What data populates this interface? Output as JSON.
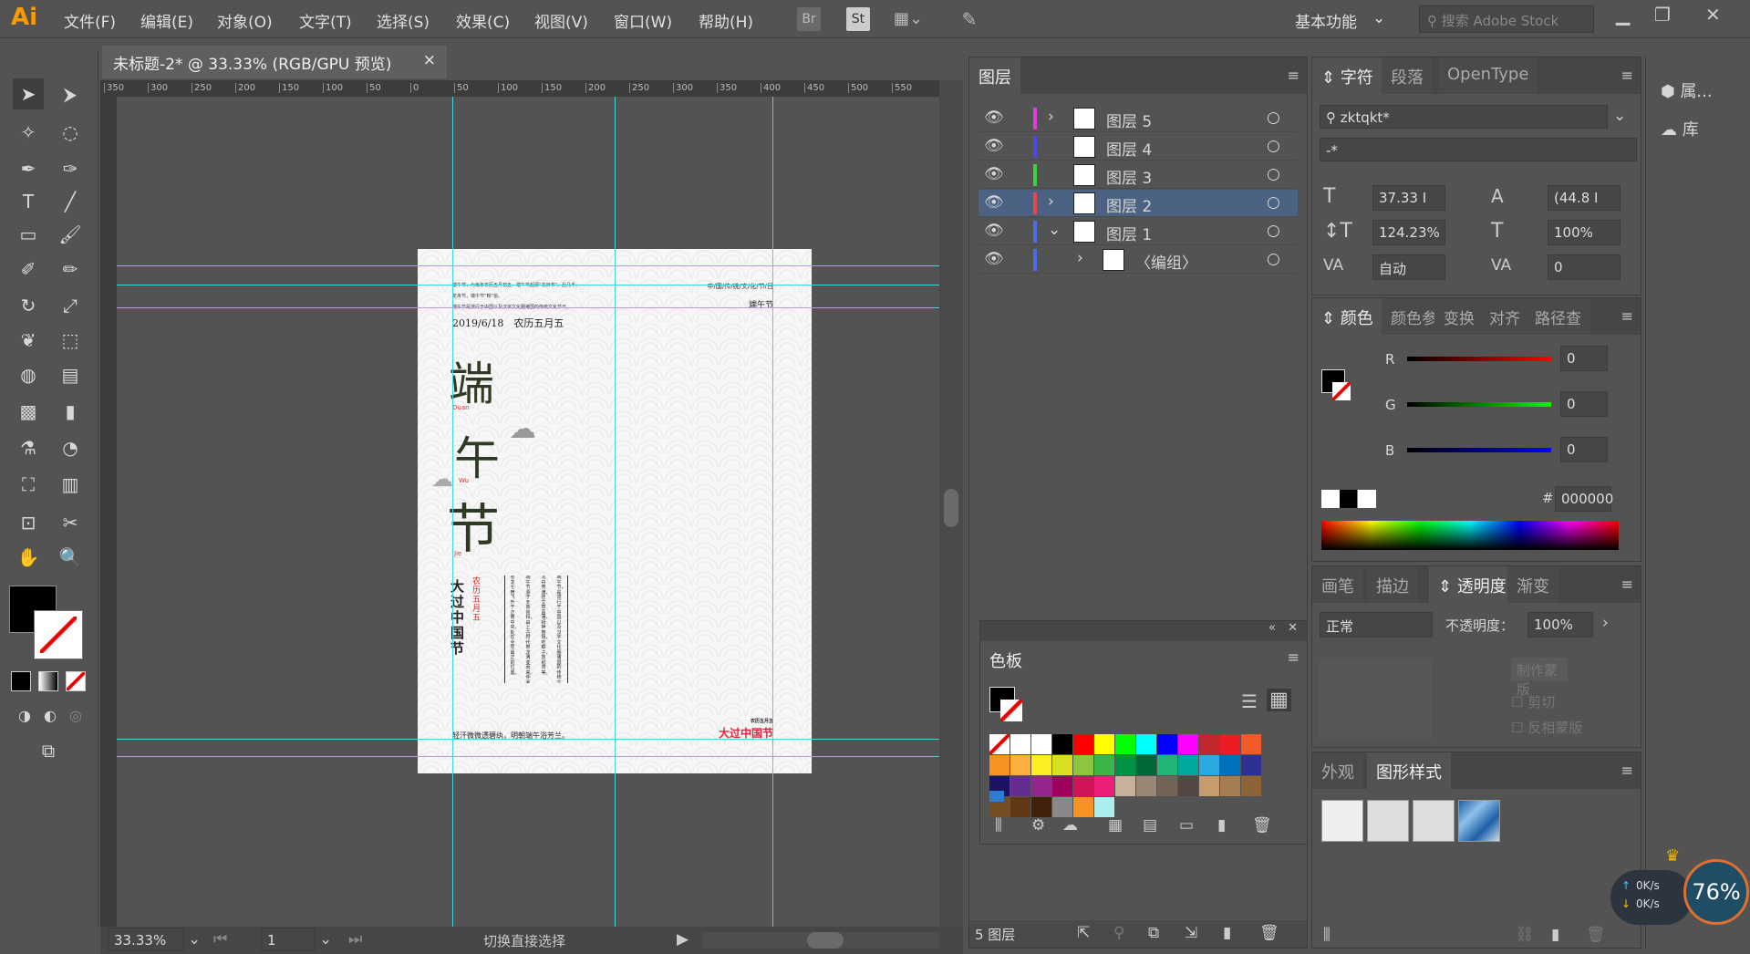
{
  "app": {
    "logo": "Ai",
    "menus": [
      "文件(F)",
      "编辑(E)",
      "对象(O)",
      "文字(T)",
      "选择(S)",
      "效果(C)",
      "视图(V)",
      "窗口(W)",
      "帮助(H)"
    ],
    "bridge": "Br",
    "stock": "St",
    "workspace": "基本功能",
    "search_placeholder": "搜索 Adobe Stock"
  },
  "document": {
    "tab_title": "未标题-2* @ 33.33% (RGB/GPU 预览)",
    "close": "×",
    "ruler_ticks": [
      "350",
      "300",
      "250",
      "200",
      "150",
      "100",
      "50",
      "0",
      "50",
      "100",
      "150",
      "200",
      "250",
      "300",
      "350",
      "400",
      "450",
      "500",
      "550"
    ]
  },
  "artboard": {
    "intro_lines": [
      "端午节，为每年农历五月初五。端午节起源“龙日节”，后几千。",
      "龙舟节，端午节“粽”俗。",
      "端午节是流行于中国以及汉字文化圈诸国的传统文化节日。"
    ],
    "top_right_line": "中/国/传/统/文/化/节/日",
    "top_right_title": "端午节",
    "date": "2019/6/18　农历五月五",
    "big_chars": [
      "端",
      "午",
      "节"
    ],
    "pinyin": [
      "Duan",
      "Wu",
      "Jie"
    ],
    "vertical_title": "大过中国节",
    "vertical_red": "农历五月五",
    "columns": [
      "端午节，是流行于中国以及汉字文化圈诸国的传统文化节日，",
      "龙舟竞渡、挂艾草菖蒲、拜神祭祖、吃粽子、放纸鸢等。",
      "端午节源于天象崇拜，由上古时代祭龙演变而来。仲夏端午，",
      "苍龙七宿飞升于正南中央，处在全年最正的位置。"
    ],
    "bottom_poem": "轻汗微微透碧纨，明朝端午浴芳兰。",
    "bottom_small": "农历五月五",
    "bottom_red": "大过中国节"
  },
  "status": {
    "zoom": "33.33%",
    "artboard_num": "1",
    "tool_hint": "切换直接选择"
  },
  "layers": {
    "tab": "图层",
    "rows": [
      {
        "name": "图层 5",
        "color": "#e23cdc",
        "expand": "›"
      },
      {
        "name": "图层 4",
        "color": "#4b4be8",
        "expand": ""
      },
      {
        "name": "图层 3",
        "color": "#3cd23c",
        "expand": ""
      },
      {
        "name": "图层 2",
        "color": "#e84848",
        "expand": "›",
        "selected": true
      },
      {
        "name": "图层 1",
        "color": "#4b6ee8",
        "expand": "⌄"
      },
      {
        "name": "〈编组〉",
        "color": "#4b6ee8",
        "expand": "›"
      }
    ],
    "count": "5 图层"
  },
  "character": {
    "tabs": [
      "字符",
      "段落",
      "OpenType"
    ],
    "font": "zktqkt*",
    "style": "-*",
    "size": "37.33 I",
    "leading": "(44.8 I",
    "vscale": "124.23%",
    "hscale": "100%",
    "kerning": "自动",
    "tracking": "0"
  },
  "color": {
    "tabs": [
      "颜色",
      "颜色参",
      "变换",
      "对齐",
      "路径查"
    ],
    "r": "0",
    "g": "0",
    "b": "0",
    "hex_label": "#",
    "hex": "000000"
  },
  "transparency": {
    "tabs": [
      "画笔",
      "描边",
      "透明度",
      "渐变"
    ],
    "mode": "正常",
    "opacity_label": "不透明度：",
    "opacity": "100%",
    "make_mask": "制作蒙版",
    "clip": "剪切",
    "invert": "反相蒙版"
  },
  "appearance": {
    "tabs": [
      "外观",
      "图形样式"
    ]
  },
  "swatches": {
    "tab": "色板",
    "colors": [
      "#ffffff",
      "#ffffff",
      "#ffffff",
      "#000000",
      "#ff0000",
      "#ffff00",
      "#00ff00",
      "#00ffff",
      "#0000ff",
      "#ff00ff",
      "#c1272d",
      "#ed1c24",
      "#f15a24",
      "#f7931e",
      "#fbb03b",
      "#fcee21",
      "#d9e021",
      "#8cc63f",
      "#39b54a",
      "#009245",
      "#006837",
      "#22b573",
      "#00a99d",
      "#29abe2",
      "#0071bc",
      "#2e3192",
      "#1b1464",
      "#662d91",
      "#93278f",
      "#9e005d",
      "#d4145a",
      "#ed1e79",
      "#c7b299",
      "#998675",
      "#736357",
      "#534741",
      "#c69c6d",
      "#a67c52",
      "#8c6239",
      "#754c24",
      "#603813",
      "#42210b",
      "#888888",
      "#f7931e",
      "#aee"
    ]
  },
  "right_dock": {
    "properties": "属...",
    "libraries": "库"
  },
  "widget": {
    "up": "0K/s",
    "down": "0K/s",
    "percent": "76%"
  }
}
